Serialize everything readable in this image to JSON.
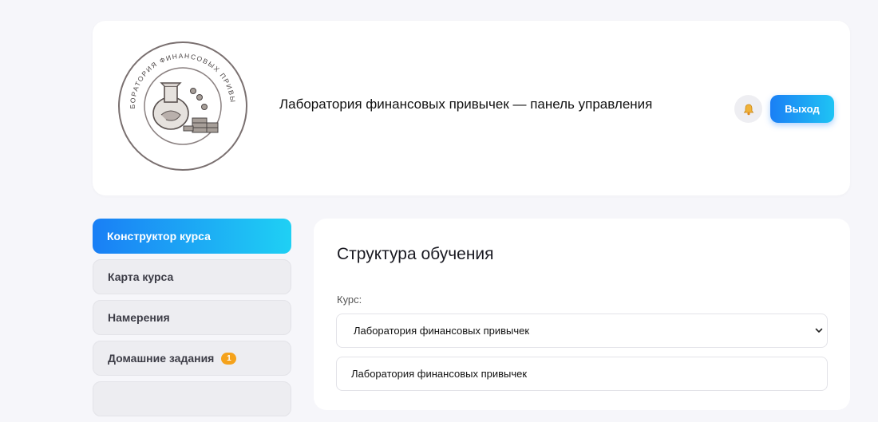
{
  "header": {
    "logo_ring_text": "ЛАБОРАТОРИЯ ФИНАНСОВЫХ ПРИВЫЧЕК",
    "title": "Лаборатория финансовых привычек — панель управления",
    "bell_icon": "bell-icon",
    "logout_label": "Выход"
  },
  "sidebar": {
    "items": [
      {
        "label": "Конструктор курса",
        "active": true
      },
      {
        "label": "Карта курса"
      },
      {
        "label": "Намерения"
      },
      {
        "label": "Домашние задания",
        "badge": "1"
      }
    ]
  },
  "main": {
    "title": "Структура обучения",
    "course_label": "Курс:",
    "course_select": "Лаборатория финансовых привычек",
    "course_name": "Лаборатория финансовых привычек"
  },
  "colors": {
    "accent_start": "#1a7ff5",
    "accent_end": "#1fc4f4",
    "badge": "#f5a21b",
    "background": "#f6f6fa"
  }
}
